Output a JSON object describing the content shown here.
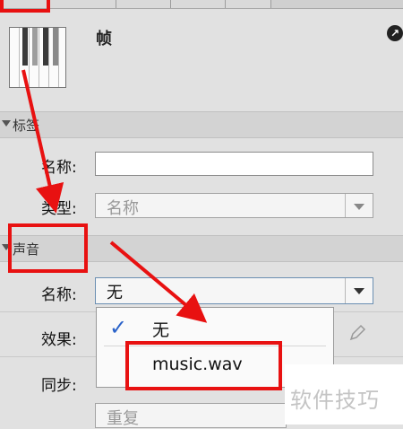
{
  "frame": {
    "title": "帧"
  },
  "sections": {
    "label_section": "标签",
    "sound_section": "声音"
  },
  "label_props": {
    "name_label": "名称:",
    "name_value": "",
    "type_label": "类型:",
    "type_value": "名称"
  },
  "sound_props": {
    "name_label": "名称:",
    "name_value": "无",
    "effect_label": "效果:",
    "sync_label": "同步:",
    "repeat_value": "重复"
  },
  "dropdown": {
    "options": [
      "无",
      "music.wav"
    ],
    "selected": "无"
  },
  "watermark": "软件技巧",
  "colors": {
    "annotation": "#e81111",
    "check": "#2a62c9"
  }
}
